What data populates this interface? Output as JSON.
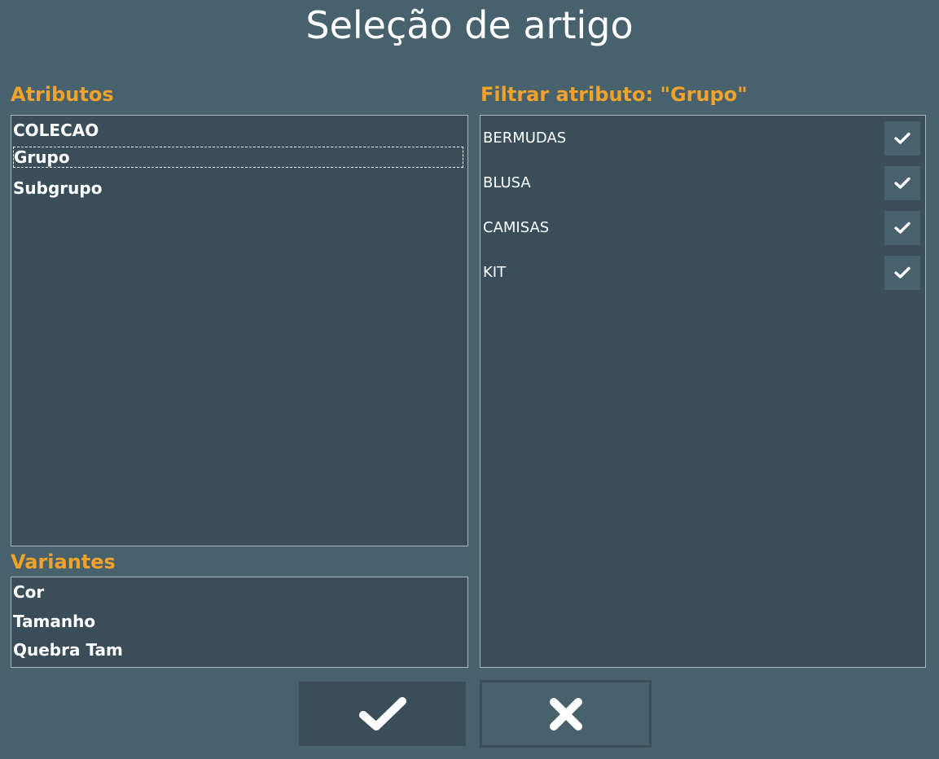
{
  "window": {
    "title": "Seleção de artigo"
  },
  "atributos": {
    "label": "Atributos",
    "items": [
      "COLECAO",
      "Grupo",
      "Subgrupo"
    ],
    "selected": "Grupo"
  },
  "variantes": {
    "label": "Variantes",
    "items": [
      "Cor",
      "Tamanho",
      "Quebra Tam"
    ]
  },
  "filter": {
    "label": "Filtrar atributo: \"Grupo\"",
    "items": [
      {
        "label": "BERMUDAS",
        "checked": true
      },
      {
        "label": "BLUSA",
        "checked": true
      },
      {
        "label": "CAMISAS",
        "checked": true
      },
      {
        "label": "KIT",
        "checked": true
      }
    ]
  },
  "buttons": {
    "confirm_icon": "check-icon",
    "cancel_icon": "close-icon"
  },
  "colors": {
    "background": "#47616d",
    "panel": "#394e59",
    "accent": "#f0a22b",
    "text": "#ffffff"
  }
}
